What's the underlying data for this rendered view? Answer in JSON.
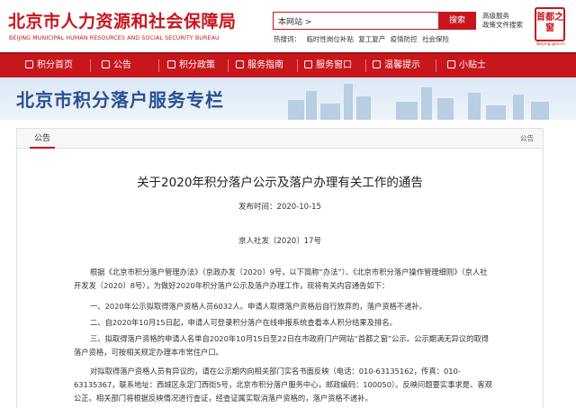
{
  "header": {
    "logo_cn": "北京市人力资源和社会保障局",
    "logo_en": "BEIJING MUNICIPAL HUMAN RESOURCES AND SOCIAL SECURITY BUREAU",
    "search_scope": "本网站 >",
    "search_button": "搜索",
    "advanced_search": "高级服务",
    "policy_search": "政策文件搜索",
    "hot_label": "热搜词：",
    "hot_words": [
      "临时性岗位补贴",
      "复工复产",
      "疫情防控",
      "社会保险"
    ],
    "seal_text": "首都之窗",
    "seal_sub": "Beijing.gov.cn"
  },
  "nav": {
    "items": [
      "积分首页",
      "公告",
      "积分政策",
      "服务指南",
      "服务窗口",
      "温馨提示",
      "小贴士"
    ]
  },
  "banner": {
    "title": "北京市积分落户服务专栏"
  },
  "panel": {
    "tab": "公告",
    "breadcrumb": "公告"
  },
  "article": {
    "title": "关于2020年积分落户公示及落户办理有关工作的通告",
    "date": "发布时间：2020-10-15",
    "doc_no": "京人社发〔2020〕17号",
    "paragraphs": [
      "根据《北京市积分落户管理办法》（京政办发〔2020〕9号，以下简称“办法”）、《北京市积分落户操作管理细则》（京人社开发发〔2020〕8号），为做好2020年积分落户公示及落户办理工作，现将有关内容通告如下：",
      "一、2020年公示拟取得落户资格人员6032人。申请人取得落户资格后自行放弃的，落户资格不递补。",
      "二、自2020年10月15日起，申请人可登录积分落户在线申报系统查看本人积分结果及排名。",
      "三、拟取得落户资格的申请人名单自2020年10月15日至22日在市政府门户网站“首都之窗”公示。公示期满无异议的取得落户资格，可按相关规定办理本市常住户口。",
      "对拟取得落户资格人员有异议的，请在公示期内向相关部门实名书面反映（电话：010-63135162，传真：010-63135367，联系地址：西城区永定门西街5号，北京市积分落户服务中心，邮政编码：100050）。反映问题要实事求是、客观公正。相关部门将根据反映情况进行查证，经查证属实取消落户资格的，落户资格不递补。"
    ]
  },
  "colors": {
    "brand_red": "#c8161d",
    "banner_blue": "#2a4f93"
  }
}
